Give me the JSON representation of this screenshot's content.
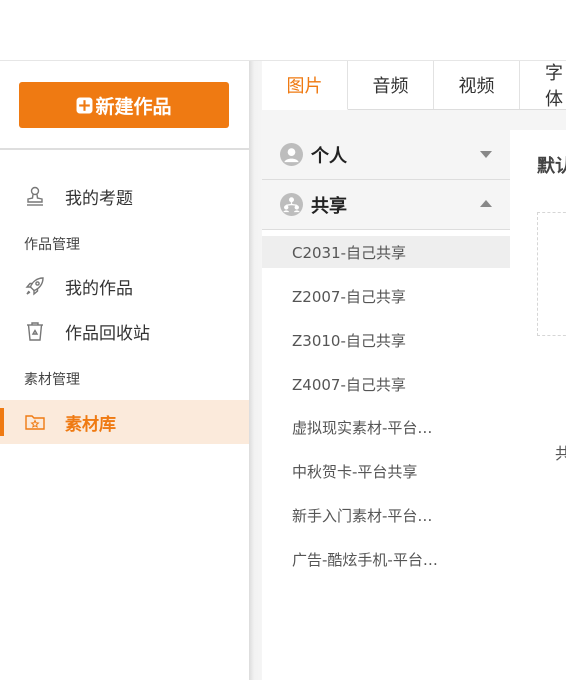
{
  "sidebar": {
    "new_button_label": "新建作品",
    "nav": {
      "my_questions": "我的考题",
      "group_works": "作品管理",
      "my_works": "我的作品",
      "recycle_bin": "作品回收站",
      "group_materials": "素材管理",
      "material_library": "素材库"
    }
  },
  "tabs": [
    "图片",
    "音频",
    "视频",
    "字体"
  ],
  "folders": {
    "personal": "个人",
    "shared": "共享",
    "items": [
      "C2031-自己共享",
      "Z2007-自己共享",
      "Z3010-自己共享",
      "Z4007-自己共享",
      "虚拟现实素材-平台…",
      "中秋贺卡-平台共享",
      "新手入门素材-平台…",
      "广告-酷炫手机-平台…"
    ]
  },
  "content": {
    "title": "默认",
    "note": "共"
  },
  "colors": {
    "accent": "#ef7a12",
    "active_bg": "#fbeadb"
  }
}
